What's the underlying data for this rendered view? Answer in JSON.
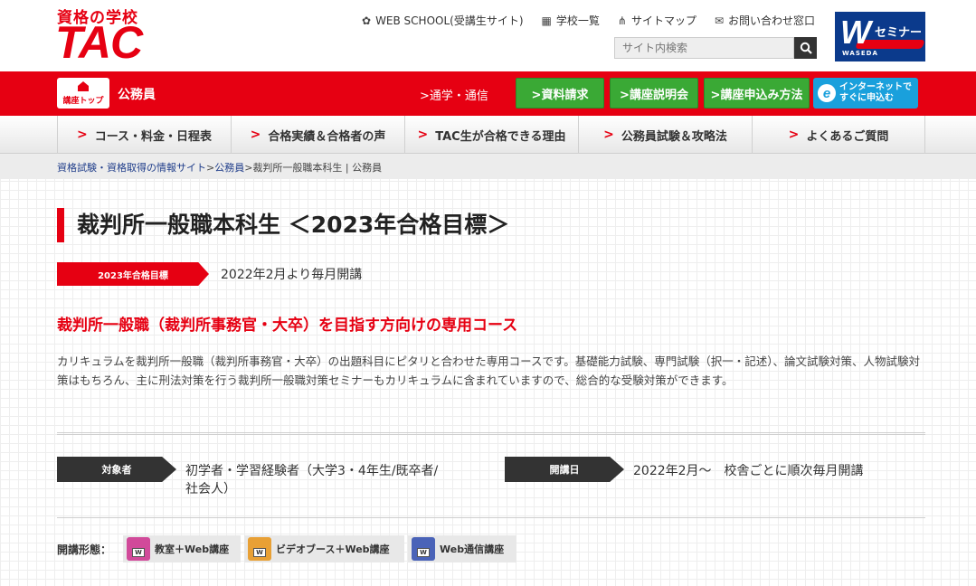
{
  "header": {
    "logo_top": "資格の学校",
    "logo_main": "TAC",
    "top_links": [
      {
        "icon": "gear-icon",
        "glyph": "✿",
        "label": "WEB SCHOOL(受講生サイト)"
      },
      {
        "icon": "building-icon",
        "glyph": "▦",
        "label": "学校一覧"
      },
      {
        "icon": "sitemap-icon",
        "glyph": "⋔",
        "label": "サイトマップ"
      },
      {
        "icon": "mail-icon",
        "glyph": "✉",
        "label": "お問い合わせ窓口"
      }
    ],
    "search_placeholder": "サイト内検索",
    "partner_logo": {
      "w": "W",
      "seminar": "セミナー",
      "waseda": "WASEDA"
    }
  },
  "redbar": {
    "top_button_label": "講座トップ",
    "category": "公務員",
    "tsushin_link": ">通学・通信",
    "buttons": [
      ">資料請求",
      ">講座説明会",
      ">講座申込み方法"
    ],
    "internet_button": [
      "インターネットで",
      "すぐに申込む"
    ]
  },
  "nav": {
    "items": [
      "コース・料金・日程表",
      "合格実績＆合格者の声",
      "TAC生が合格できる理由",
      "公務員試験＆攻略法",
      "よくあるご質問"
    ]
  },
  "breadcrumb": {
    "link1": "資格試験・資格取得の情報サイト",
    "sep1": ">",
    "link2": "公務員",
    "sep2": ">",
    "current": "裁判所一般職本科生 | 公務員"
  },
  "main": {
    "title": "裁判所一般職本科生 ＜2023年合格目標＞",
    "tag": "2023年合格目標",
    "tag_text": "2022年2月より毎月開講",
    "subhead": "裁判所一般職（裁判所事務官・大卒）を目指す方向けの専用コース",
    "description": "カリキュラムを裁判所一般職（裁判所事務官・大卒）の出題科目にピタリと合わせた専用コースです。基礎能力試験、専門試験（択一・記述）、論文試験対策、人物試験対策はもちろん、主に刑法対策を行う裁判所一般職対策セミナーもカリキュラムに含まれていますので、総合的な受験対策ができます。",
    "target_label": "対象者",
    "target_value_line1": "初学者・学習経験者（大学3・4年生/既卒者/",
    "target_value_line2": "社会人）",
    "start_label": "開講日",
    "start_value": "2022年2月～　校舎ごとに順次毎月開講",
    "forms_label": "開講形態：",
    "forms": [
      {
        "icon": "classroom-icon",
        "label": "教室＋Web講座",
        "color": "#d14a9a"
      },
      {
        "icon": "video-booth-icon",
        "label": "ビデオブース＋Web講座",
        "color": "#e8a035"
      },
      {
        "icon": "web-course-icon",
        "label": "Web通信講座",
        "color": "#4a63b8"
      }
    ]
  },
  "colors": {
    "brand_red": "#e60012",
    "green_button": "#3aa935",
    "blue_button": "#1aa0dc",
    "dark_tag": "#333333"
  }
}
